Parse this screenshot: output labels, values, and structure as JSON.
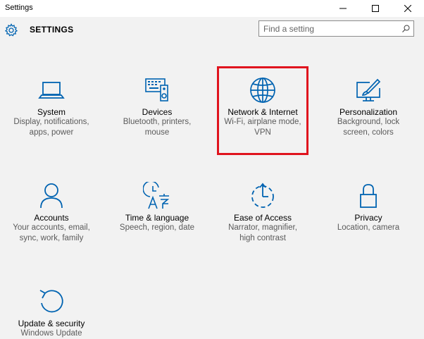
{
  "window": {
    "title": "Settings",
    "controls": [
      "minimize",
      "maximize",
      "close"
    ]
  },
  "header": {
    "title": "SETTINGS",
    "icon": "gear-icon"
  },
  "search": {
    "placeholder": "Find a setting",
    "icon": "search-icon"
  },
  "accent_color": "#0063b1",
  "highlight_color": "#e0141e",
  "tiles": [
    {
      "name": "System",
      "desc1": "Display, notifications,",
      "desc2": "apps, power",
      "icon": "laptop-icon"
    },
    {
      "name": "Devices",
      "desc1": "Bluetooth, printers,",
      "desc2": "mouse",
      "icon": "devices-icon"
    },
    {
      "name": "Network & Internet",
      "desc1": "Wi-Fi, airplane mode,",
      "desc2": "VPN",
      "icon": "globe-icon"
    },
    {
      "name": "Personalization",
      "desc1": "Background, lock",
      "desc2": "screen, colors",
      "icon": "paint-icon"
    },
    {
      "name": "Accounts",
      "desc1": "Your accounts, email,",
      "desc2": "sync, work, family",
      "icon": "person-icon"
    },
    {
      "name": "Time & language",
      "desc1": "Speech, region, date",
      "desc2": "",
      "icon": "time-language-icon"
    },
    {
      "name": "Ease of Access",
      "desc1": "Narrator, magnifier,",
      "desc2": "high contrast",
      "icon": "ease-of-access-icon"
    },
    {
      "name": "Privacy",
      "desc1": "Location, camera",
      "desc2": "",
      "icon": "lock-icon"
    },
    {
      "name": "Update & security",
      "desc1": "Windows Update",
      "desc2": "",
      "icon": "refresh-icon"
    }
  ]
}
